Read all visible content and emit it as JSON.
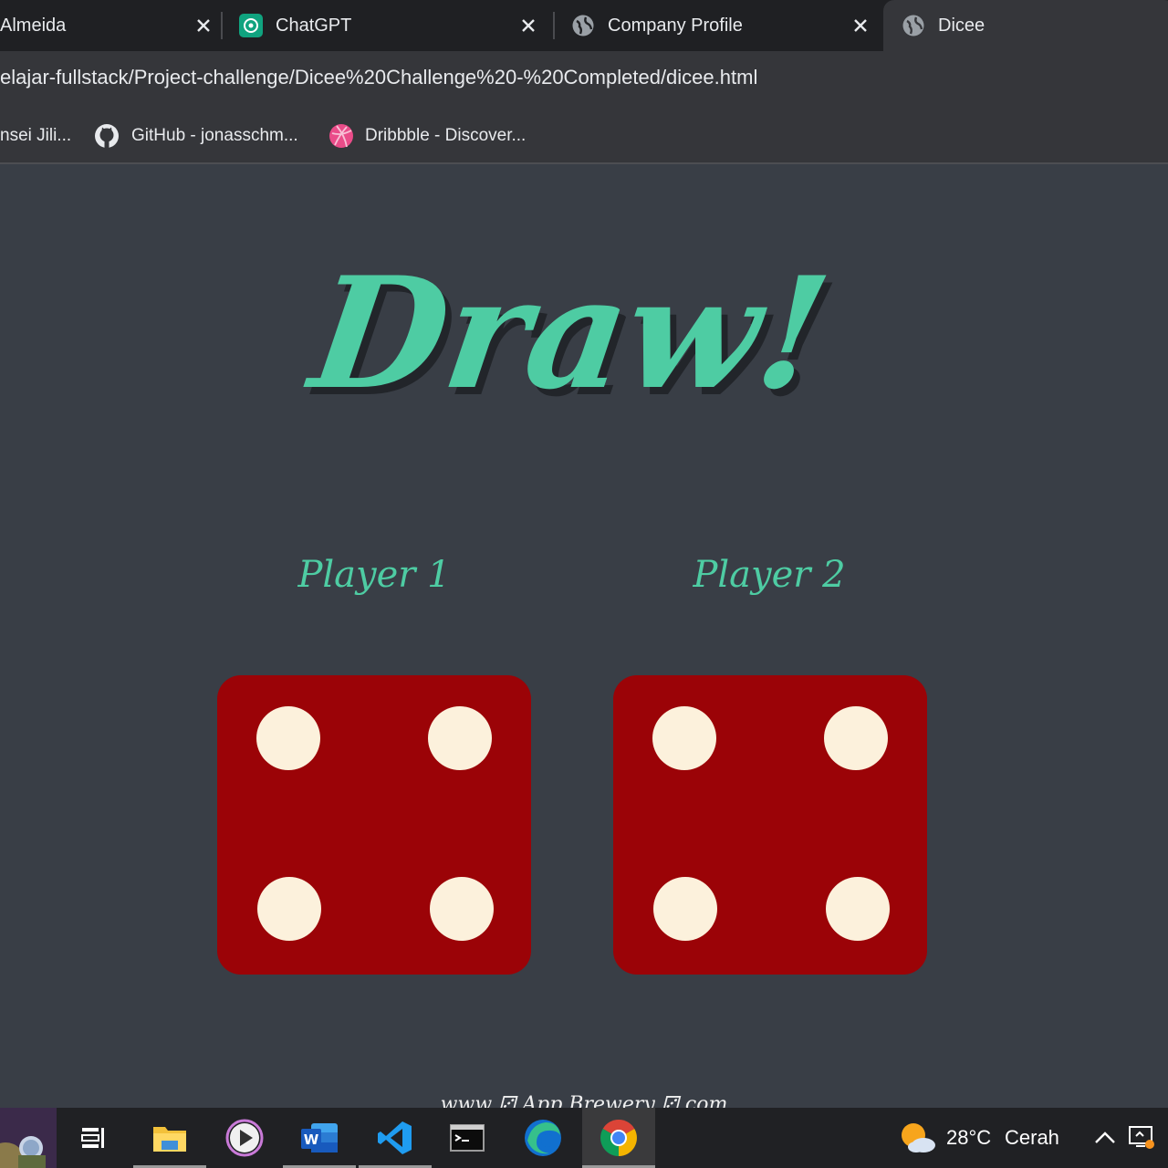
{
  "browser": {
    "tabs": [
      {
        "title": "Almeida",
        "icon": "generic-page-icon"
      },
      {
        "title": "ChatGPT",
        "icon": "chatgpt-icon"
      },
      {
        "title": "Company Profile",
        "icon": "globe-icon"
      },
      {
        "title": "Dicee",
        "icon": "globe-icon",
        "active": true
      }
    ],
    "url": "elajar-fullstack/Project-challenge/Dicee%20Challenge%20-%20Completed/dicee.html",
    "bookmarks": [
      {
        "label": "nsei Jili..."
      },
      {
        "label": "GitHub - jonasschm...",
        "icon": "github-icon"
      },
      {
        "label": "Dribbble - Discover...",
        "icon": "dribbble-icon"
      }
    ]
  },
  "page": {
    "headline": "Draw!",
    "players": [
      {
        "label": "Player 1",
        "die_value": 4
      },
      {
        "label": "Player 2",
        "die_value": 4
      }
    ],
    "footer": "www ⚂ App Brewery ⚂ com"
  },
  "colors": {
    "page_bg": "#393e46",
    "accent": "#4ecca3",
    "die": "#9b0307",
    "pip": "#fcf1dc"
  },
  "taskbar": {
    "apps": [
      "start-icon",
      "task-view-icon",
      "file-explorer-icon",
      "media-player-icon",
      "word-icon",
      "vscode-icon",
      "terminal-icon",
      "edge-icon",
      "chrome-icon"
    ],
    "weather": {
      "temp": "28°C",
      "condition": "Cerah",
      "icon": "partly-sunny-icon"
    }
  }
}
